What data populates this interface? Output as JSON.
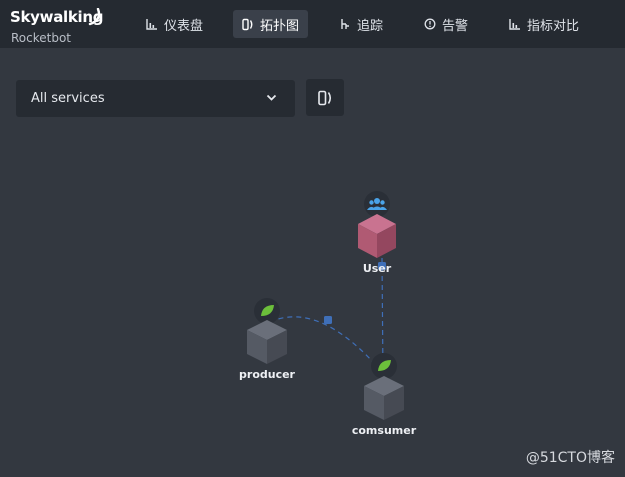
{
  "brand": {
    "title": "Skywalking",
    "subtitle": "Rocketbot"
  },
  "nav": [
    {
      "label": "仪表盘",
      "icon": "bar-chart-icon",
      "active": false
    },
    {
      "label": "拓扑图",
      "icon": "topology-icon",
      "active": true
    },
    {
      "label": "追踪",
      "icon": "trace-icon",
      "active": false
    },
    {
      "label": "告警",
      "icon": "alarm-icon",
      "active": false
    },
    {
      "label": "指标对比",
      "icon": "bar-chart-icon",
      "active": false
    }
  ],
  "service_select": {
    "value": "All services"
  },
  "topology": {
    "nodes": [
      {
        "id": "user",
        "label": "User",
        "kind": "user",
        "color": "#b05a73",
        "badge_icon": "users-icon"
      },
      {
        "id": "producer",
        "label": "producer",
        "kind": "service",
        "color": "#5a5f6a",
        "badge_icon": "spring-leaf-icon"
      },
      {
        "id": "comsumer",
        "label": "comsumer",
        "kind": "service",
        "color": "#5a5f6a",
        "badge_icon": "spring-leaf-icon"
      }
    ],
    "edges": [
      {
        "from": "user",
        "to": "comsumer"
      },
      {
        "from": "producer",
        "to": "comsumer"
      }
    ],
    "edge_color": "#3f6fb8"
  },
  "watermark": "@51CTO博客"
}
